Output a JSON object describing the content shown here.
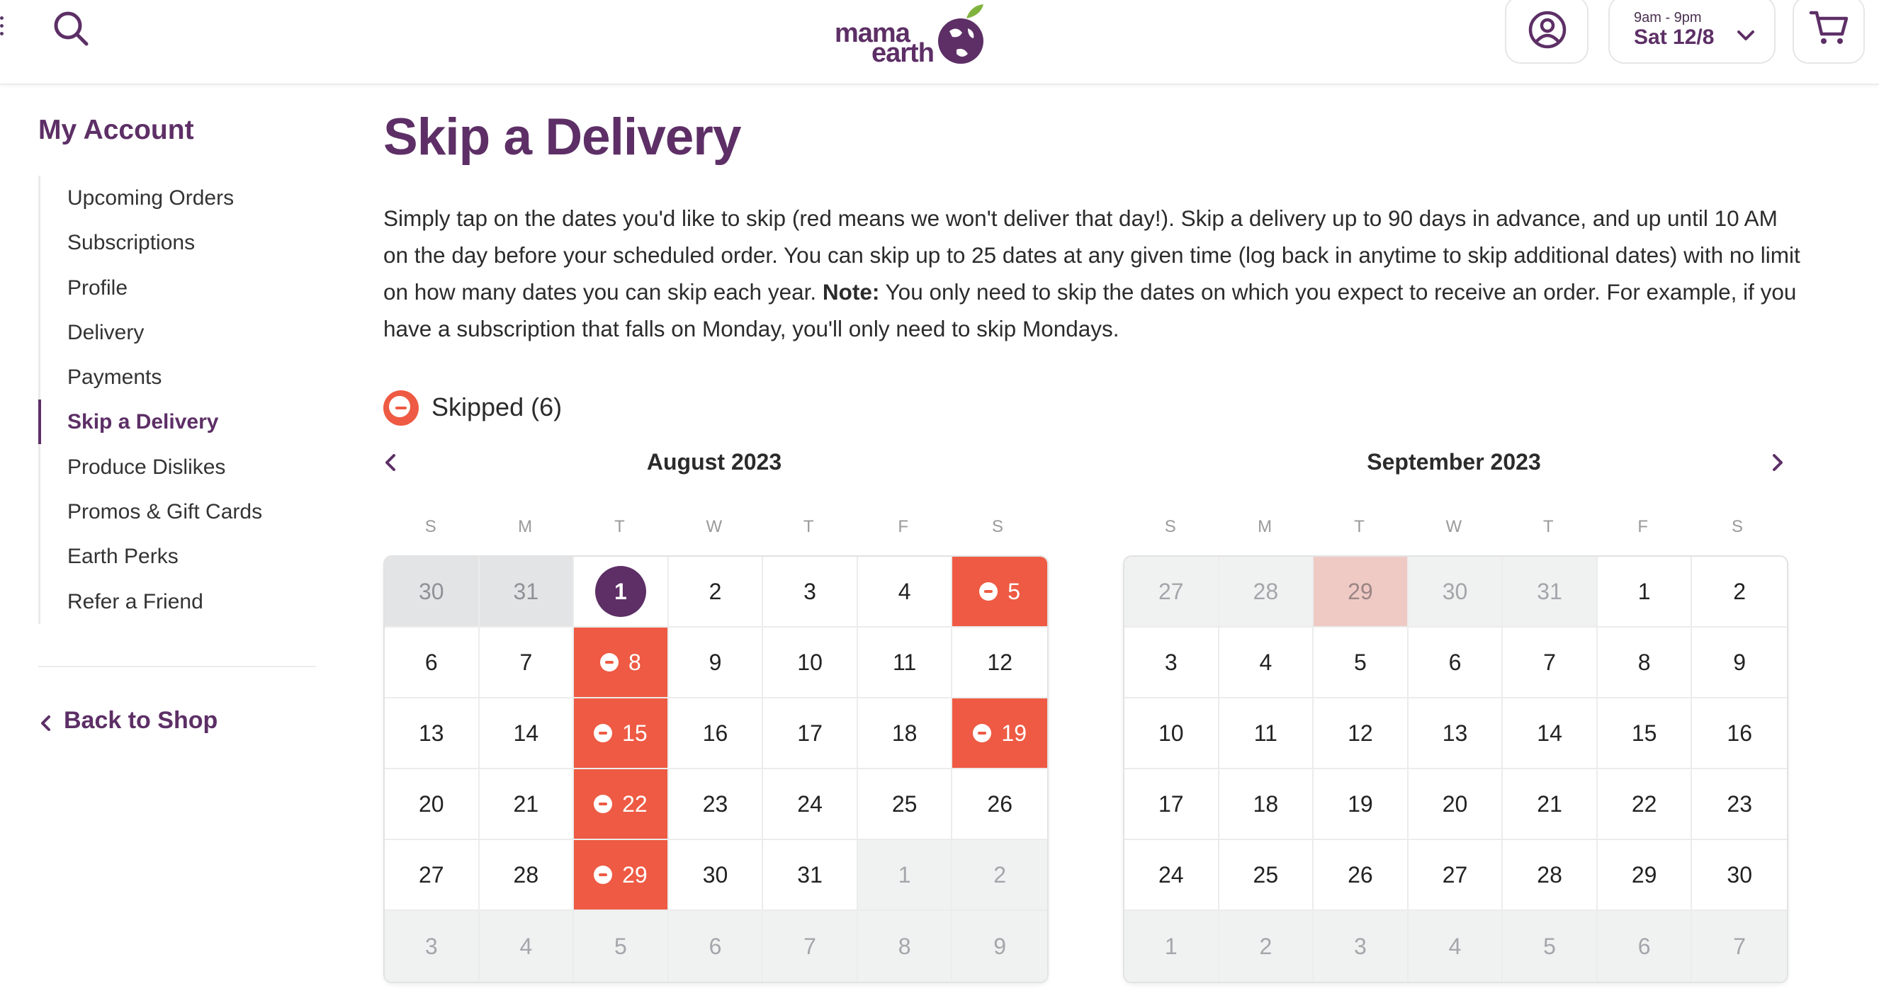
{
  "header": {
    "logo_line1": "mama",
    "logo_line2": "earth",
    "delivery_hours": "9am - 9pm",
    "delivery_date": "Sat 12/8"
  },
  "sidebar": {
    "title": "My Account",
    "items": [
      {
        "label": "Upcoming Orders",
        "active": false
      },
      {
        "label": "Subscriptions",
        "active": false
      },
      {
        "label": "Profile",
        "active": false
      },
      {
        "label": "Delivery",
        "active": false
      },
      {
        "label": "Payments",
        "active": false
      },
      {
        "label": "Skip a Delivery",
        "active": true
      },
      {
        "label": "Produce Dislikes",
        "active": false
      },
      {
        "label": "Promos & Gift Cards",
        "active": false
      },
      {
        "label": "Earth Perks",
        "active": false
      },
      {
        "label": "Refer a Friend",
        "active": false
      }
    ],
    "back_label": "Back to Shop"
  },
  "main": {
    "title": "Skip a Delivery",
    "intro_part1": "Simply tap on the dates you'd like to skip (red means we won't deliver that day!). Skip a delivery up to 90 days in advance, and up until 10 AM on the day before your scheduled order. You can skip up to 25 dates at any given time (log back in anytime to skip additional dates) with no limit on how many dates you can skip each year. ",
    "intro_note_label": "Note:",
    "intro_part2": " You only need to skip the dates on which you expect to receive an order. For example, if you have a subscription that falls on Monday, you'll only need to skip Mondays.",
    "legend_label": "Skipped (6)"
  },
  "colors": {
    "brand_purple": "#5d2f66",
    "skip_red": "#ee5a43"
  },
  "calendars": [
    {
      "title": "August 2023",
      "weekdays": [
        "S",
        "M",
        "T",
        "W",
        "T",
        "F",
        "S"
      ],
      "days": [
        {
          "n": "30",
          "s": "past"
        },
        {
          "n": "31",
          "s": "past"
        },
        {
          "n": "1",
          "s": "today"
        },
        {
          "n": "2",
          "s": ""
        },
        {
          "n": "3",
          "s": ""
        },
        {
          "n": "4",
          "s": ""
        },
        {
          "n": "5",
          "s": "skipped"
        },
        {
          "n": "6",
          "s": ""
        },
        {
          "n": "7",
          "s": ""
        },
        {
          "n": "8",
          "s": "skipped"
        },
        {
          "n": "9",
          "s": ""
        },
        {
          "n": "10",
          "s": ""
        },
        {
          "n": "11",
          "s": ""
        },
        {
          "n": "12",
          "s": ""
        },
        {
          "n": "13",
          "s": ""
        },
        {
          "n": "14",
          "s": ""
        },
        {
          "n": "15",
          "s": "skipped"
        },
        {
          "n": "16",
          "s": ""
        },
        {
          "n": "17",
          "s": ""
        },
        {
          "n": "18",
          "s": ""
        },
        {
          "n": "19",
          "s": "skipped"
        },
        {
          "n": "20",
          "s": ""
        },
        {
          "n": "21",
          "s": ""
        },
        {
          "n": "22",
          "s": "skipped"
        },
        {
          "n": "23",
          "s": ""
        },
        {
          "n": "24",
          "s": ""
        },
        {
          "n": "25",
          "s": ""
        },
        {
          "n": "26",
          "s": ""
        },
        {
          "n": "27",
          "s": ""
        },
        {
          "n": "28",
          "s": ""
        },
        {
          "n": "29",
          "s": "skipped"
        },
        {
          "n": "30",
          "s": ""
        },
        {
          "n": "31",
          "s": ""
        },
        {
          "n": "1",
          "s": "outside"
        },
        {
          "n": "2",
          "s": "outside"
        },
        {
          "n": "3",
          "s": "outside"
        },
        {
          "n": "4",
          "s": "outside"
        },
        {
          "n": "5",
          "s": "outside"
        },
        {
          "n": "6",
          "s": "outside"
        },
        {
          "n": "7",
          "s": "outside"
        },
        {
          "n": "8",
          "s": "outside"
        },
        {
          "n": "9",
          "s": "outside"
        }
      ]
    },
    {
      "title": "September 2023",
      "weekdays": [
        "S",
        "M",
        "T",
        "W",
        "T",
        "F",
        "S"
      ],
      "days": [
        {
          "n": "27",
          "s": "outside"
        },
        {
          "n": "28",
          "s": "outside"
        },
        {
          "n": "29",
          "s": "skip-past"
        },
        {
          "n": "30",
          "s": "outside"
        },
        {
          "n": "31",
          "s": "outside"
        },
        {
          "n": "1",
          "s": ""
        },
        {
          "n": "2",
          "s": ""
        },
        {
          "n": "3",
          "s": ""
        },
        {
          "n": "4",
          "s": ""
        },
        {
          "n": "5",
          "s": ""
        },
        {
          "n": "6",
          "s": ""
        },
        {
          "n": "7",
          "s": ""
        },
        {
          "n": "8",
          "s": ""
        },
        {
          "n": "9",
          "s": ""
        },
        {
          "n": "10",
          "s": ""
        },
        {
          "n": "11",
          "s": ""
        },
        {
          "n": "12",
          "s": ""
        },
        {
          "n": "13",
          "s": ""
        },
        {
          "n": "14",
          "s": ""
        },
        {
          "n": "15",
          "s": ""
        },
        {
          "n": "16",
          "s": ""
        },
        {
          "n": "17",
          "s": ""
        },
        {
          "n": "18",
          "s": ""
        },
        {
          "n": "19",
          "s": ""
        },
        {
          "n": "20",
          "s": ""
        },
        {
          "n": "21",
          "s": ""
        },
        {
          "n": "22",
          "s": ""
        },
        {
          "n": "23",
          "s": ""
        },
        {
          "n": "24",
          "s": ""
        },
        {
          "n": "25",
          "s": ""
        },
        {
          "n": "26",
          "s": ""
        },
        {
          "n": "27",
          "s": ""
        },
        {
          "n": "28",
          "s": ""
        },
        {
          "n": "29",
          "s": ""
        },
        {
          "n": "30",
          "s": ""
        },
        {
          "n": "1",
          "s": "outside"
        },
        {
          "n": "2",
          "s": "outside"
        },
        {
          "n": "3",
          "s": "outside"
        },
        {
          "n": "4",
          "s": "outside"
        },
        {
          "n": "5",
          "s": "outside"
        },
        {
          "n": "6",
          "s": "outside"
        },
        {
          "n": "7",
          "s": "outside"
        }
      ]
    }
  ]
}
